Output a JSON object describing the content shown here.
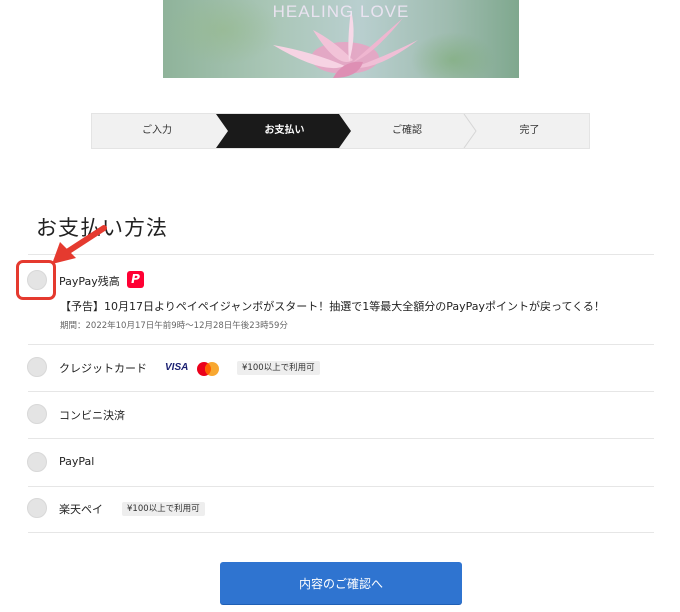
{
  "banner": {
    "title": "HEALING LOVE"
  },
  "steps": [
    {
      "label": "ご入力",
      "active": false
    },
    {
      "label": "お支払い",
      "active": true
    },
    {
      "label": "ご確認",
      "active": false
    },
    {
      "label": "完了",
      "active": false
    }
  ],
  "section_title": "お支払い方法",
  "payment_options": [
    {
      "label": "PayPay残高",
      "icon": "paypay-icon"
    },
    {
      "label": "クレジットカード",
      "brands": [
        "VISA",
        "mastercard"
      ],
      "badge": "¥100以上で利用可"
    },
    {
      "label": "コンビニ決済"
    },
    {
      "label": "PayPal"
    },
    {
      "label": "楽天ペイ",
      "badge": "¥100以上で利用可"
    }
  ],
  "paypay_notice": "【予告】10月17日よりペイペイジャンボがスタート！抽選で1等最大全額分のPayPayポイントが戻ってくる！",
  "paypay_period": "期間：2022年10月17日午前9時〜12月28日午後23時59分",
  "confirm_button": "内容のご確認へ",
  "colors": {
    "accent": "#2f74d0",
    "highlight": "#e53a2f",
    "paypay": "#ff0033",
    "active_step": "#1a1a1a"
  }
}
